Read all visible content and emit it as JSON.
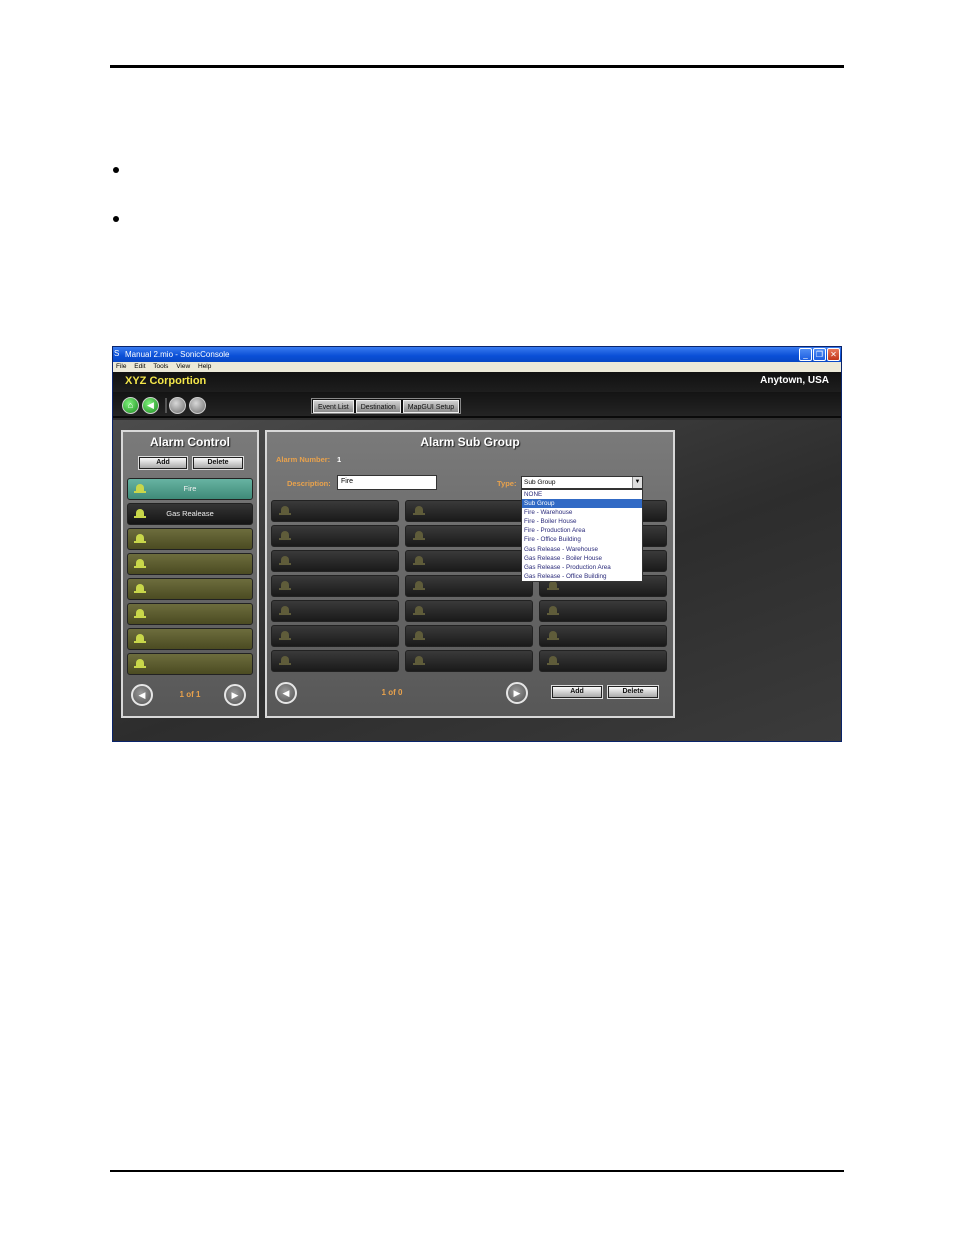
{
  "window": {
    "title": "Manual 2.mio - SonicConsole",
    "buttons": {
      "minimize": "_",
      "restore": "❐",
      "close": "✕"
    }
  },
  "menu": [
    "File",
    "Edit",
    "Tools",
    "View",
    "Help"
  ],
  "header": {
    "company": "XYZ Corportion",
    "location": "Anytown, USA"
  },
  "toolbar": {
    "home_glyph": "⌂",
    "back_glyph": "◀",
    "tabs": [
      "Event List",
      "Destination",
      "MapGUI Setup"
    ]
  },
  "alarm_control": {
    "title": "Alarm Control",
    "add_label": "Add",
    "delete_label": "Delete",
    "items": [
      "Fire",
      "Gas Realease",
      "",
      "",
      "",
      "",
      "",
      ""
    ],
    "pager": "1 of 1",
    "prev_glyph": "◀",
    "next_glyph": "▶"
  },
  "sub_group": {
    "title": "Alarm Sub Group",
    "alarm_number_label": "Alarm Number:",
    "alarm_number_value": "1",
    "description_label": "Description:",
    "description_value": "Fire",
    "type_label": "Type:",
    "type_value": "Sub Group",
    "type_arrow": "▼",
    "type_options": [
      "NONE",
      "Sub Group",
      "Fire - Warehouse",
      "Fire - Boiler House",
      "Fire - Production  Area",
      "Fire - Office Building",
      "Gas Release - Warehouse",
      "Gas Release - Boiler House",
      "Gas Release - Production Area",
      "Gas Release - Office Building"
    ],
    "selected_option": "Sub Group",
    "pager": "1 of 0",
    "add_label": "Add",
    "delete_label": "Delete",
    "prev_glyph": "◀",
    "next_glyph": "▶"
  }
}
